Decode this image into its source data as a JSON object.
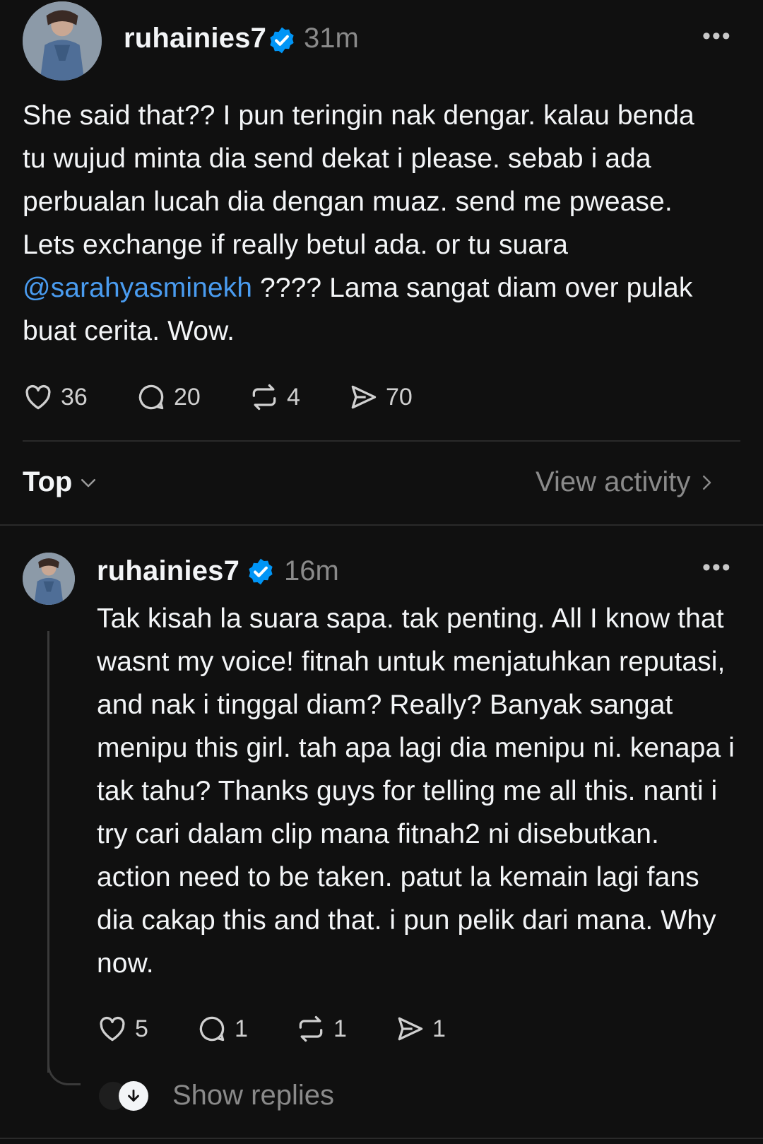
{
  "post": {
    "username": "ruhainies7",
    "time": "31m",
    "text_before_mention": "She said that?? I pun teringin nak dengar. kalau benda tu wujud minta dia send dekat i please. sebab i ada perbualan lucah dia dengan muaz. send me pwease. Lets exchange if really betul ada. or tu suara ",
    "mention": "@sarahyasminekh",
    "text_after_mention": " ???? Lama sangat diam over pulak buat cerita. Wow.",
    "likes": "36",
    "comments": "20",
    "reposts": "4",
    "shares": "70"
  },
  "sort": {
    "label": "Top",
    "view_activity": "View activity"
  },
  "reply": {
    "username": "ruhainies7",
    "time": "16m",
    "text": "Tak kisah la suara sapa. tak penting. All I know that wasnt my voice! fitnah untuk menjatuhkan reputasi, and nak i tinggal diam? Really? Banyak sangat menipu this girl.  tah apa lagi dia menipu ni. kenapa i tak tahu? Thanks guys for telling me all this. nanti i try cari dalam clip mana fitnah2 ni disebutkan. action need to be taken. patut la kemain lagi fans dia cakap this and that. i pun pelik dari mana. Why now.",
    "likes": "5",
    "comments": "1",
    "reposts": "1",
    "shares": "1",
    "show_replies": "Show replies"
  },
  "icons": {
    "like": "heart-icon",
    "comment": "comment-icon",
    "repost": "repost-icon",
    "share": "share-icon",
    "verified": "verified-badge-icon",
    "more": "more-icon"
  },
  "colors": {
    "background": "#101010",
    "text": "#f3f5f7",
    "muted": "#8a8a8a",
    "mention": "#4a9cf0",
    "verified": "#0095f6"
  }
}
